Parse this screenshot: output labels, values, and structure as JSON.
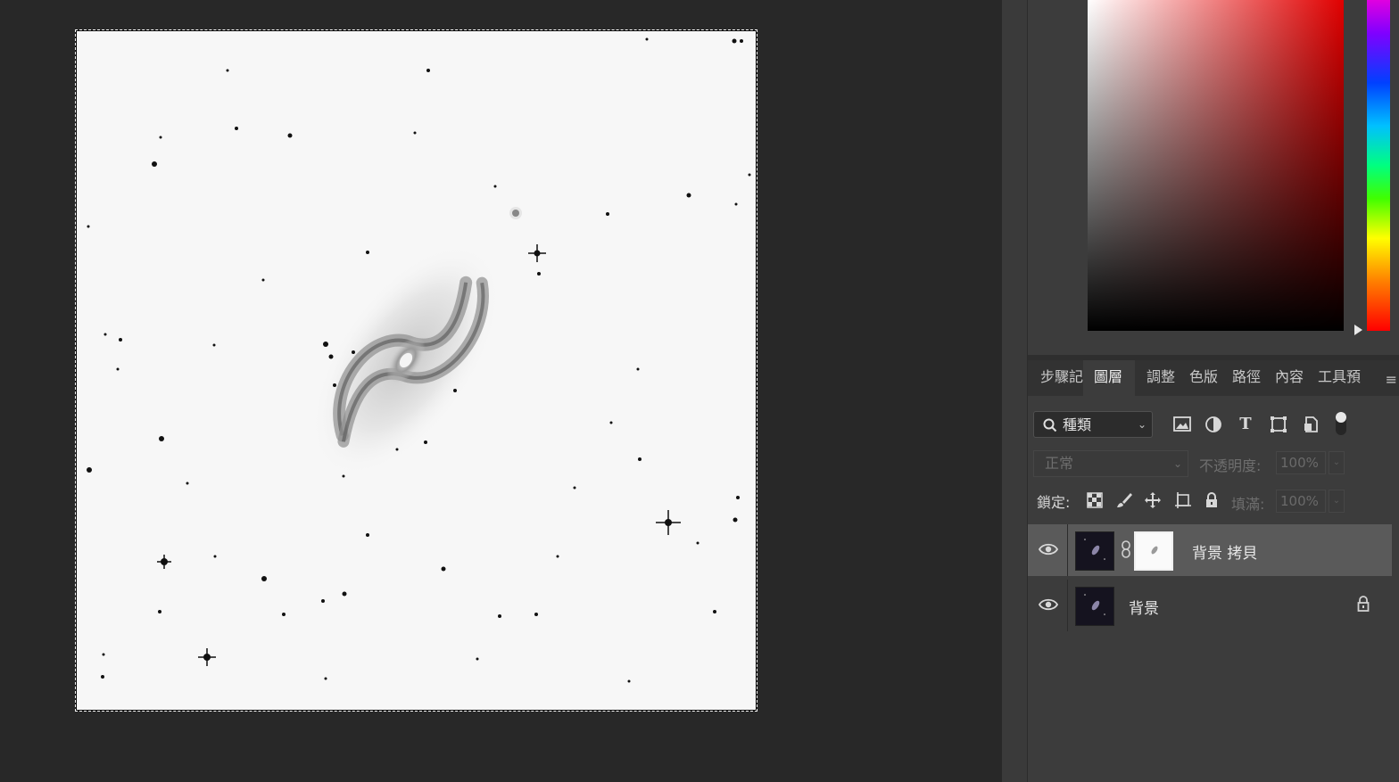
{
  "canvas": {
    "image_description_name": "galaxy-inverted-image"
  },
  "tabs": [
    {
      "label": "步驟記",
      "active": false
    },
    {
      "label": "圖層",
      "active": true
    },
    {
      "label": "調整",
      "active": false
    },
    {
      "label": "色版",
      "active": false
    },
    {
      "label": "路徑",
      "active": false
    },
    {
      "label": "內容",
      "active": false
    },
    {
      "label": "工具預",
      "active": false
    }
  ],
  "tab_menu_icon": "≡",
  "filter": {
    "label": "種類",
    "icons": [
      "image-filter-icon",
      "adjustment-filter-icon",
      "type-filter-icon",
      "shape-filter-icon",
      "smart-object-filter-icon"
    ]
  },
  "blend": {
    "mode": "正常",
    "opacity_label": "不透明度:",
    "opacity_value": "100%"
  },
  "lock": {
    "label": "鎖定:",
    "fill_label": "填滿:",
    "fill_value": "100%"
  },
  "layers": [
    {
      "name": "背景 拷貝",
      "selected": true,
      "has_mask": true,
      "locked": false
    },
    {
      "name": "背景",
      "selected": false,
      "has_mask": false,
      "locked": true
    }
  ],
  "colors": {
    "accent_red": "#e00000",
    "panel_bg": "#3c3c3c",
    "workspace_bg": "#282828"
  }
}
